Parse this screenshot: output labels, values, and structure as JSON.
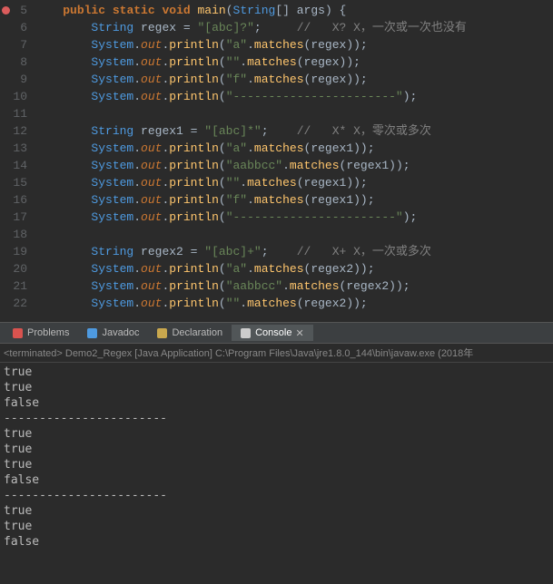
{
  "editor": {
    "lines": [
      {
        "num": 5,
        "breakpoint": true,
        "indent": "    ",
        "tokens": [
          [
            "kw",
            "public"
          ],
          [
            "punc",
            " "
          ],
          [
            "kw",
            "static"
          ],
          [
            "punc",
            " "
          ],
          [
            "kw",
            "void"
          ],
          [
            "punc",
            " "
          ],
          [
            "method",
            "main"
          ],
          [
            "punc",
            "("
          ],
          [
            "type",
            "String"
          ],
          [
            "punc",
            "[] args) {"
          ]
        ]
      },
      {
        "num": 6,
        "indent": "        ",
        "tokens": [
          [
            "type",
            "String"
          ],
          [
            "punc",
            " "
          ],
          [
            "op",
            "regex"
          ],
          [
            "punc",
            " = "
          ],
          [
            "str",
            "\"[abc]?\""
          ],
          [
            "punc",
            ";     "
          ],
          [
            "comment",
            "//   X? X，一次或一次也没有"
          ]
        ]
      },
      {
        "num": 7,
        "indent": "        ",
        "tokens": [
          [
            "type",
            "System"
          ],
          [
            "punc",
            "."
          ],
          [
            "field",
            "out"
          ],
          [
            "punc",
            "."
          ],
          [
            "method",
            "println"
          ],
          [
            "punc",
            "("
          ],
          [
            "str",
            "\"a\""
          ],
          [
            "punc",
            "."
          ],
          [
            "method",
            "matches"
          ],
          [
            "punc",
            "(regex));"
          ]
        ]
      },
      {
        "num": 8,
        "indent": "        ",
        "tokens": [
          [
            "type",
            "System"
          ],
          [
            "punc",
            "."
          ],
          [
            "field",
            "out"
          ],
          [
            "punc",
            "."
          ],
          [
            "method",
            "println"
          ],
          [
            "punc",
            "("
          ],
          [
            "str",
            "\"\""
          ],
          [
            "punc",
            "."
          ],
          [
            "method",
            "matches"
          ],
          [
            "punc",
            "(regex));"
          ]
        ]
      },
      {
        "num": 9,
        "indent": "        ",
        "tokens": [
          [
            "type",
            "System"
          ],
          [
            "punc",
            "."
          ],
          [
            "field",
            "out"
          ],
          [
            "punc",
            "."
          ],
          [
            "method",
            "println"
          ],
          [
            "punc",
            "("
          ],
          [
            "str",
            "\"f\""
          ],
          [
            "punc",
            "."
          ],
          [
            "method",
            "matches"
          ],
          [
            "punc",
            "(regex));"
          ]
        ]
      },
      {
        "num": 10,
        "indent": "        ",
        "tokens": [
          [
            "type",
            "System"
          ],
          [
            "punc",
            "."
          ],
          [
            "field",
            "out"
          ],
          [
            "punc",
            "."
          ],
          [
            "method",
            "println"
          ],
          [
            "punc",
            "("
          ],
          [
            "str",
            "\"-----------------------\""
          ],
          [
            "punc",
            ");"
          ]
        ]
      },
      {
        "num": 11,
        "indent": "",
        "tokens": []
      },
      {
        "num": 12,
        "indent": "        ",
        "tokens": [
          [
            "type",
            "String"
          ],
          [
            "punc",
            " "
          ],
          [
            "op",
            "regex1"
          ],
          [
            "punc",
            " = "
          ],
          [
            "str",
            "\"[abc]*\""
          ],
          [
            "punc",
            ";    "
          ],
          [
            "comment",
            "//   X* X，零次或多次"
          ]
        ]
      },
      {
        "num": 13,
        "indent": "        ",
        "tokens": [
          [
            "type",
            "System"
          ],
          [
            "punc",
            "."
          ],
          [
            "field",
            "out"
          ],
          [
            "punc",
            "."
          ],
          [
            "method",
            "println"
          ],
          [
            "punc",
            "("
          ],
          [
            "str",
            "\"a\""
          ],
          [
            "punc",
            "."
          ],
          [
            "method",
            "matches"
          ],
          [
            "punc",
            "(regex1));"
          ]
        ]
      },
      {
        "num": 14,
        "indent": "        ",
        "tokens": [
          [
            "type",
            "System"
          ],
          [
            "punc",
            "."
          ],
          [
            "field",
            "out"
          ],
          [
            "punc",
            "."
          ],
          [
            "method",
            "println"
          ],
          [
            "punc",
            "("
          ],
          [
            "str",
            "\"aabbcc\""
          ],
          [
            "punc",
            "."
          ],
          [
            "method",
            "matches"
          ],
          [
            "punc",
            "(regex1));"
          ]
        ]
      },
      {
        "num": 15,
        "indent": "        ",
        "tokens": [
          [
            "type",
            "System"
          ],
          [
            "punc",
            "."
          ],
          [
            "field",
            "out"
          ],
          [
            "punc",
            "."
          ],
          [
            "method",
            "println"
          ],
          [
            "punc",
            "("
          ],
          [
            "str",
            "\"\""
          ],
          [
            "punc",
            "."
          ],
          [
            "method",
            "matches"
          ],
          [
            "punc",
            "(regex1));"
          ]
        ]
      },
      {
        "num": 16,
        "indent": "        ",
        "tokens": [
          [
            "type",
            "System"
          ],
          [
            "punc",
            "."
          ],
          [
            "field",
            "out"
          ],
          [
            "punc",
            "."
          ],
          [
            "method",
            "println"
          ],
          [
            "punc",
            "("
          ],
          [
            "str",
            "\"f\""
          ],
          [
            "punc",
            "."
          ],
          [
            "method",
            "matches"
          ],
          [
            "punc",
            "(regex1));"
          ]
        ]
      },
      {
        "num": 17,
        "indent": "        ",
        "tokens": [
          [
            "type",
            "System"
          ],
          [
            "punc",
            "."
          ],
          [
            "field",
            "out"
          ],
          [
            "punc",
            "."
          ],
          [
            "method",
            "println"
          ],
          [
            "punc",
            "("
          ],
          [
            "str",
            "\"-----------------------\""
          ],
          [
            "punc",
            ");"
          ]
        ]
      },
      {
        "num": 18,
        "indent": "",
        "tokens": []
      },
      {
        "num": 19,
        "indent": "        ",
        "tokens": [
          [
            "type",
            "String"
          ],
          [
            "punc",
            " "
          ],
          [
            "op",
            "regex2"
          ],
          [
            "punc",
            " = "
          ],
          [
            "str",
            "\"[abc]+\""
          ],
          [
            "punc",
            ";    "
          ],
          [
            "comment",
            "//   X+ X，一次或多次"
          ]
        ]
      },
      {
        "num": 20,
        "indent": "        ",
        "tokens": [
          [
            "type",
            "System"
          ],
          [
            "punc",
            "."
          ],
          [
            "field",
            "out"
          ],
          [
            "punc",
            "."
          ],
          [
            "method",
            "println"
          ],
          [
            "punc",
            "("
          ],
          [
            "str",
            "\"a\""
          ],
          [
            "punc",
            "."
          ],
          [
            "method",
            "matches"
          ],
          [
            "punc",
            "(regex2));"
          ]
        ]
      },
      {
        "num": 21,
        "indent": "        ",
        "tokens": [
          [
            "type",
            "System"
          ],
          [
            "punc",
            "."
          ],
          [
            "field",
            "out"
          ],
          [
            "punc",
            "."
          ],
          [
            "method",
            "println"
          ],
          [
            "punc",
            "("
          ],
          [
            "str",
            "\"aabbcc\""
          ],
          [
            "punc",
            "."
          ],
          [
            "method",
            "matches"
          ],
          [
            "punc",
            "(regex2));"
          ]
        ]
      },
      {
        "num": 22,
        "indent": "        ",
        "tokens": [
          [
            "type",
            "System"
          ],
          [
            "punc",
            "."
          ],
          [
            "field",
            "out"
          ],
          [
            "punc",
            "."
          ],
          [
            "method",
            "println"
          ],
          [
            "punc",
            "("
          ],
          [
            "str",
            "\"\""
          ],
          [
            "punc",
            "."
          ],
          [
            "method",
            "matches"
          ],
          [
            "punc",
            "(regex2));"
          ]
        ]
      }
    ]
  },
  "tabs": {
    "items": [
      {
        "id": "problems",
        "label": "Problems",
        "iconColor": "#d9534f"
      },
      {
        "id": "javadoc",
        "label": "Javadoc",
        "iconColor": "#4e9ae0"
      },
      {
        "id": "declaration",
        "label": "Declaration",
        "iconColor": "#c9a84e"
      },
      {
        "id": "console",
        "label": "Console",
        "iconColor": "#ccc",
        "active": true,
        "closable": true
      }
    ]
  },
  "terminated": "<terminated> Demo2_Regex [Java Application] C:\\Program Files\\Java\\jre1.8.0_144\\bin\\javaw.exe (2018年",
  "console": {
    "lines": [
      "true",
      "true",
      "false",
      "-----------------------",
      "true",
      "true",
      "true",
      "false",
      "-----------------------",
      "true",
      "true",
      "false"
    ]
  }
}
